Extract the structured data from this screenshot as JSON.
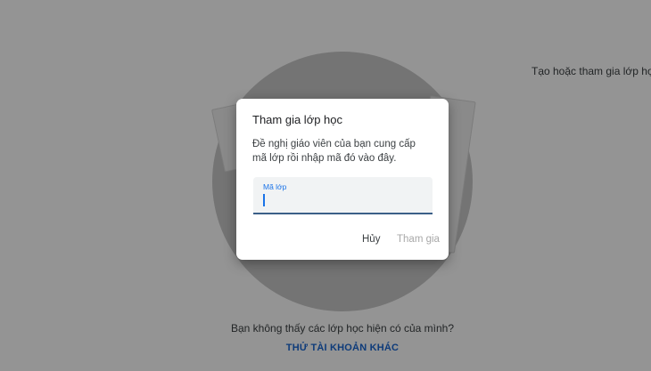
{
  "background": {
    "top_right_text": "Tạo hoặc tham gia lớp học",
    "empty_state_text": "Bạn không thấy các lớp học hiện có của mình?",
    "switch_account_link": "THỬ TÀI KHOẢN KHÁC"
  },
  "dialog": {
    "title": "Tham gia lớp học",
    "description": "Đề nghị giáo viên của bạn cung cấp mã lớp rồi nhập mã đó vào đây.",
    "field": {
      "label": "Mã lớp",
      "value": ""
    },
    "cancel_label": "Hủy",
    "join_label": "Tham gia"
  },
  "colors": {
    "accent": "#1a73e8",
    "link": "#1967d2",
    "disabled_button": "#a8a8a8"
  }
}
